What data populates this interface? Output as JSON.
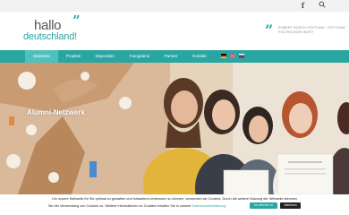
{
  "topbar": {
    "facebook_icon": "facebook-icon",
    "search_icon": "search-icon"
  },
  "header": {
    "logo_line1": "hallo",
    "logo_line2": "deutschland!",
    "logo_quote": "”",
    "sponsor_quote": "”",
    "sponsor_text": "ROBERT BOSCH STIFTUNG / STIFTUNG POLTROCKER WORT"
  },
  "nav": {
    "items": [
      {
        "label": "Startseite",
        "active": true
      },
      {
        "label": "Projekte"
      },
      {
        "label": "Stipendien"
      },
      {
        "label": "Fotogalerie"
      },
      {
        "label": "Partner"
      },
      {
        "label": "Kontakt"
      }
    ],
    "flags": [
      "German flag",
      "English flag",
      "Russian flag"
    ]
  },
  "hero": {
    "title": "Alumni-Netzwerk"
  },
  "cookie": {
    "line1": "Um unsere Webseite für Sie optimal zu gestalten und fortlaufend verbessern zu können, verwenden wir Cookies. Durch die weitere Nutzung der Webseite stimmen",
    "line2": "Sie der Verwendung von Cookies zu. Weitere Informationen zu Cookies erhalten Sie in unserer",
    "link": "Datenschutzerklärung.",
    "accept_label": "Ich stimme zu",
    "decline_label": "Ablehnen"
  },
  "colors": {
    "accent": "#2aa6a2",
    "accent_light": "#4fc1bd"
  }
}
